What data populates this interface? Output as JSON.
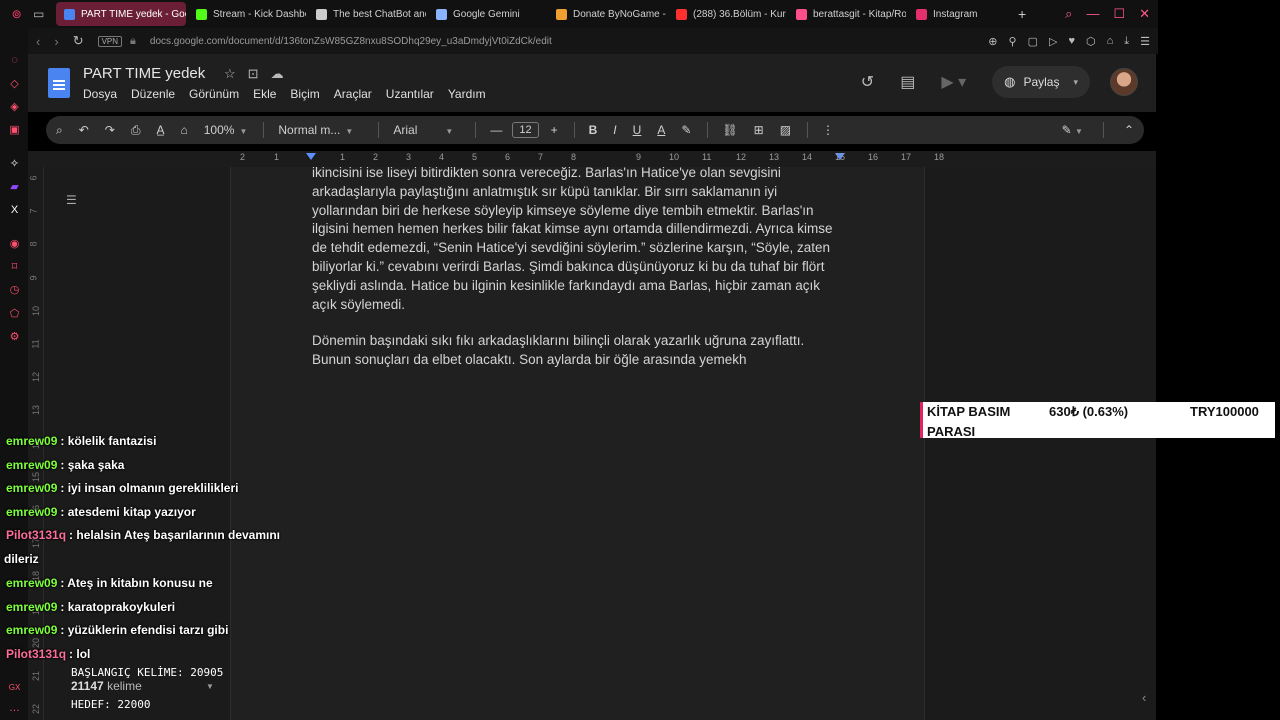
{
  "browser": {
    "tabs": [
      {
        "label": "PART TIME yedek - Goog",
        "color": "#4a84f0",
        "active": true
      },
      {
        "label": "Stream - Kick Dashbo",
        "color": "#53fc18",
        "active": false
      },
      {
        "label": "The best ChatBot and",
        "color": "#cccccc",
        "active": false
      },
      {
        "label": "Google Gemini",
        "color": "#8ab4ff",
        "active": false
      },
      {
        "label": "Donate ByNoGame - ",
        "color": "#f0a030",
        "active": false
      },
      {
        "label": "(288) 36.Bölüm - Kurt",
        "color": "#ff3030",
        "active": false
      },
      {
        "label": "berattasgit - Kitap/Ro",
        "color": "#ff4f8b",
        "active": false
      },
      {
        "label": "Instagram",
        "color": "#e1306c",
        "active": false
      }
    ],
    "vpn_label": "VPN",
    "url": "docs.google.com/document/d/136tonZsW85GZ8nxu8SODhq29ey_u3aDmdyjVt0iZdCk/edit"
  },
  "docs": {
    "title": "PART TIME  yedek",
    "menu": [
      "Dosya",
      "Düzenle",
      "Görünüm",
      "Ekle",
      "Biçim",
      "Araçlar",
      "Uzantılar",
      "Yardım"
    ],
    "share_label": "Paylaş",
    "toolbar": {
      "zoom": "100%",
      "style": "Normal m...",
      "font": "Arial",
      "font_size": "12"
    },
    "ruler_numbers": [
      "2",
      "1",
      "1",
      "2",
      "3",
      "4",
      "5",
      "6",
      "7",
      "8",
      "9",
      "10",
      "11",
      "12",
      "13",
      "14",
      "15",
      "16",
      "17",
      "18"
    ],
    "vruler_numbers": [
      "6",
      "7",
      "8",
      "9",
      "10",
      "11",
      "12",
      "13",
      "14",
      "15",
      "16",
      "17",
      "18",
      "19",
      "20",
      "21",
      "22"
    ],
    "paragraphs": [
      "ikincisini ise liseyi bitirdikten sonra vereceğiz. Barlas'ın Hatice'ye olan sevgisini arkadaşlarıyla paylaştığını anlatmıştık sır küpü tanıklar. Bir sırrı saklamanın iyi yollarından biri de herkese söyleyip kimseye söyleme diye tembih etmektir. Barlas'ın ilgisini hemen hemen herkes bilir fakat kimse aynı ortamda dillendirmezdi. Ayrıca kimse de tehdit edemezdi, “Senin Hatice'yi sevdiğini söylerim.” sözlerine karşın, “Söyle, zaten biliyorlar ki.” cevabını verirdi Barlas. Şimdi bakınca düşünüyoruz ki bu da tuhaf bir flört şekliydi aslında. Hatice bu ilginin kesinlikle farkındaydı ama Barlas, hiçbir zaman açık açık söylemedi.",
      "Dönemin başındaki sıkı fıkı arkadaşlıklarını bilinçli olarak yazarlık uğruna zayıflattı. Bunun sonuçları da elbet olacaktı. Son aylarda bir öğle arasında yemekh"
    ]
  },
  "overlay": {
    "kitap": {
      "line1": "KİTAP BASIM",
      "line2": "PARASI",
      "amount": "630₺ (0.63%)",
      "goal": "TRY100000"
    },
    "chat": [
      {
        "user": "emrew09",
        "color": "#7cff3c",
        "text": "kölelik fantazisi"
      },
      {
        "user": "emrew09",
        "color": "#7cff3c",
        "text": "şaka şaka"
      },
      {
        "user": "emrew09",
        "color": "#7cff3c",
        "text": "iyi insan olmanın gereklilikleri"
      },
      {
        "user": "emrew09",
        "color": "#7cff3c",
        "text": "atesdemi kitap yazıyor"
      },
      {
        "user": "Pilot3131q",
        "color": "#ff6e9a",
        "text": "helalsin Ateş başarılarının devamını",
        "cont": "dileriz"
      },
      {
        "user": "emrew09",
        "color": "#7cff3c",
        "text": "Ateş in kitabın konusu ne"
      },
      {
        "user": "emrew09",
        "color": "#7cff3c",
        "text": "karatoprakoykuleri"
      },
      {
        "user": "emrew09",
        "color": "#7cff3c",
        "text": "yüzüklerin efendisi tarzı gibi"
      },
      {
        "user": "Pilot3131q",
        "color": "#ff6e9a",
        "text": "lol"
      }
    ],
    "counter": {
      "start_label": "BAŞLANGIÇ KELİME: 20905",
      "word_count": "21147",
      "word_unit": "kelime",
      "target_label": "HEDEF: 22000"
    }
  },
  "colors": {
    "accent": "#4a84f0",
    "tab_active": "#6b1f37",
    "donation_bar": "#e0245e"
  }
}
